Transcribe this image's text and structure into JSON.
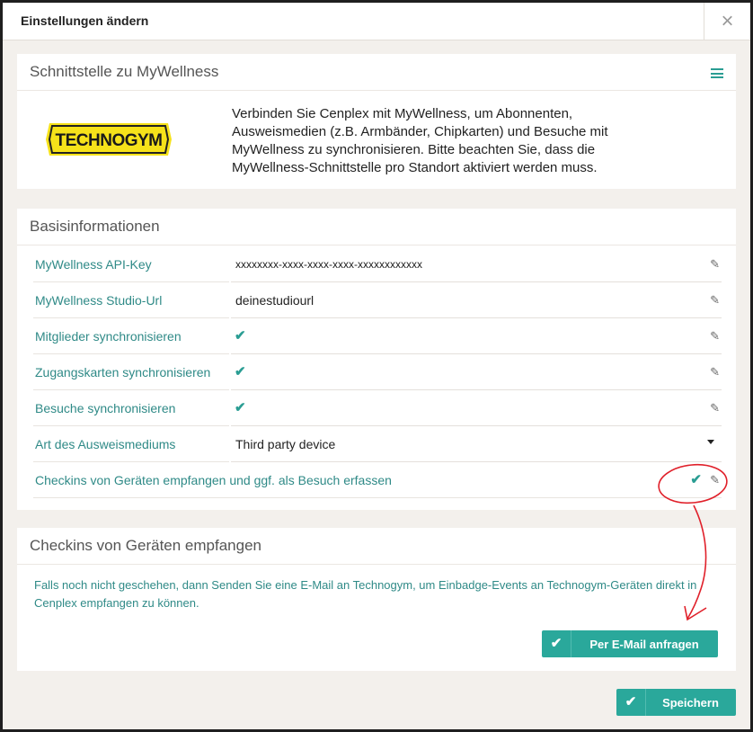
{
  "dialog": {
    "title": "Einstellungen ändern",
    "close_icon": "×"
  },
  "interface_panel": {
    "title": "Schnittstelle zu MyWellness",
    "logo_text": "TECHNOGYM",
    "description": "Verbinden Sie Cenplex mit MyWellness, um Abonnenten, Ausweismedien (z.B. Armbänder, Chipkarten) und Besuche mit MyWellness zu synchronisieren. Bitte beachten Sie, dass die MyWellness-Schnittstelle pro Standort aktiviert werden muss."
  },
  "basis": {
    "title": "Basisinformationen",
    "rows": [
      {
        "label": "MyWellness API-Key",
        "value": "xxxxxxxx-xxxx-xxxx-xxxx-xxxxxxxxxxxx"
      },
      {
        "label": "MyWellness Studio-Url",
        "value": "deinestudiourl"
      },
      {
        "label": "Mitglieder synchronisieren",
        "checked": true
      },
      {
        "label": "Zugangskarten synchronisieren",
        "checked": true
      },
      {
        "label": "Besuche synchronisieren",
        "checked": true
      },
      {
        "label": "Art des Ausweismediums",
        "value": "Third party device"
      },
      {
        "label": "Checkins von Geräten empfangen und ggf. als Besuch erfassen",
        "checked": true
      }
    ]
  },
  "checkins": {
    "title": "Checkins von Geräten empfangen",
    "info": "Falls noch nicht geschehen, dann Senden Sie eine E-Mail an Technogym, um Einbadge-Events an Technogym-Geräten direkt in Cenplex empfangen zu können.",
    "request_button": "Per E-Mail anfragen"
  },
  "footer": {
    "save_button": "Speichern"
  },
  "icons": {
    "check": "✔",
    "pencil": "✎"
  },
  "colors": {
    "accent": "#2aa89b",
    "label": "#2f8a87",
    "annotation": "#e0202a"
  }
}
